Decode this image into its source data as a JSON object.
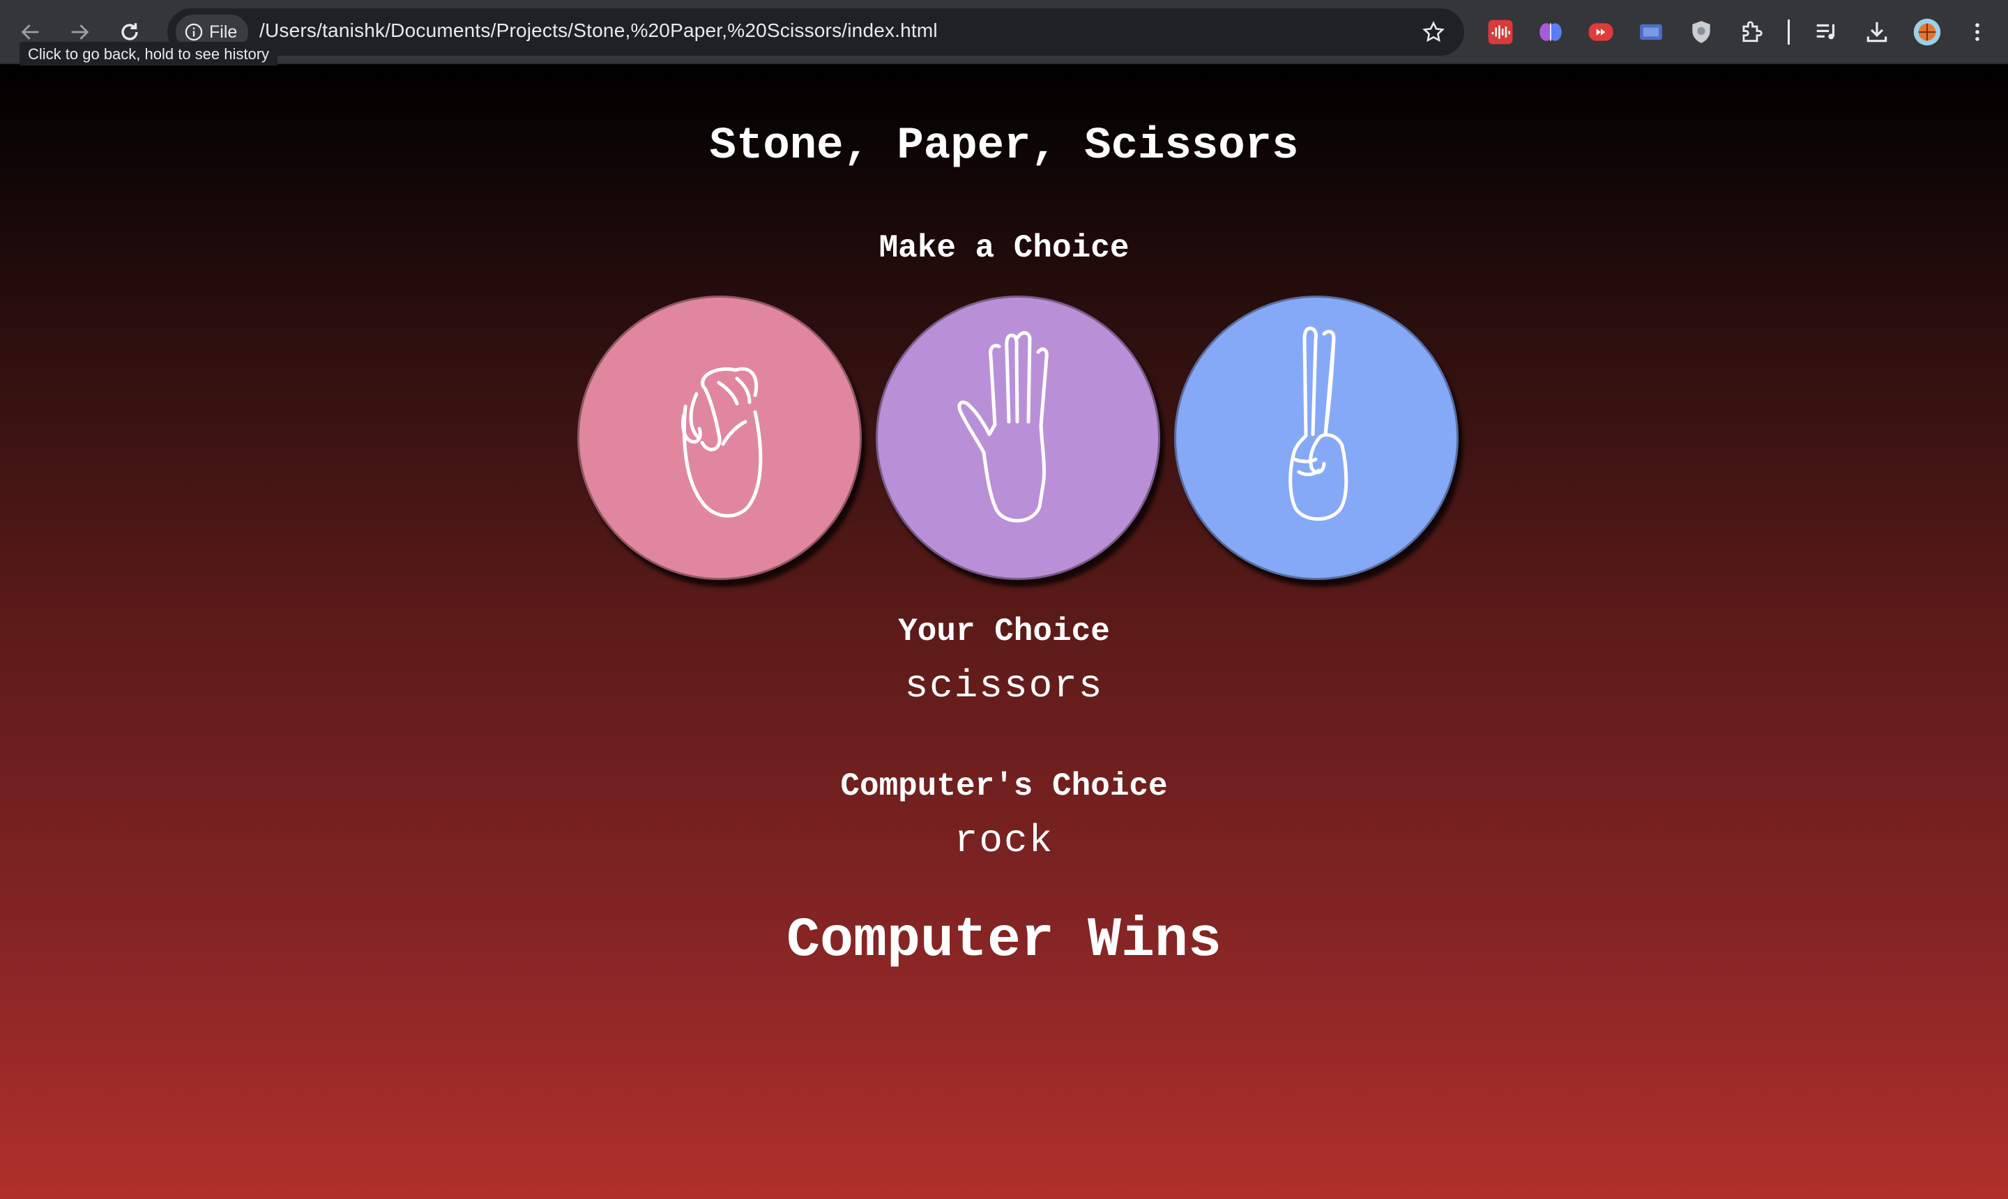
{
  "browser": {
    "site_chip_label": "File",
    "url": "/Users/tanishk/Documents/Projects/Stone,%20Paper,%20Scissors/index.html",
    "tooltip": "Click to go back, hold to see history"
  },
  "game": {
    "title": "Stone, Paper, Scissors",
    "prompt": "Make a Choice",
    "choices": [
      {
        "name": "rock",
        "color": "#e0879f"
      },
      {
        "name": "paper",
        "color": "#b990d8"
      },
      {
        "name": "scissors",
        "color": "#86a9f7"
      }
    ],
    "your_choice_label": "Your Choice",
    "your_choice_value": "scissors",
    "computer_choice_label": "Computer's Choice",
    "computer_choice_value": "rock",
    "result": "Computer Wins"
  },
  "icons": {
    "back": "arrow-left-icon",
    "forward": "arrow-right-icon",
    "reload": "reload-icon",
    "info": "info-icon",
    "bookmark": "star-icon",
    "extensions": [
      "audio-extension-icon",
      "brain-extension-icon",
      "youtube-extension-icon",
      "screen-extension-icon",
      "shield-extension-icon",
      "puzzle-icon",
      "media-queue-icon",
      "download-icon",
      "profile-avatar",
      "menu-icon"
    ]
  }
}
